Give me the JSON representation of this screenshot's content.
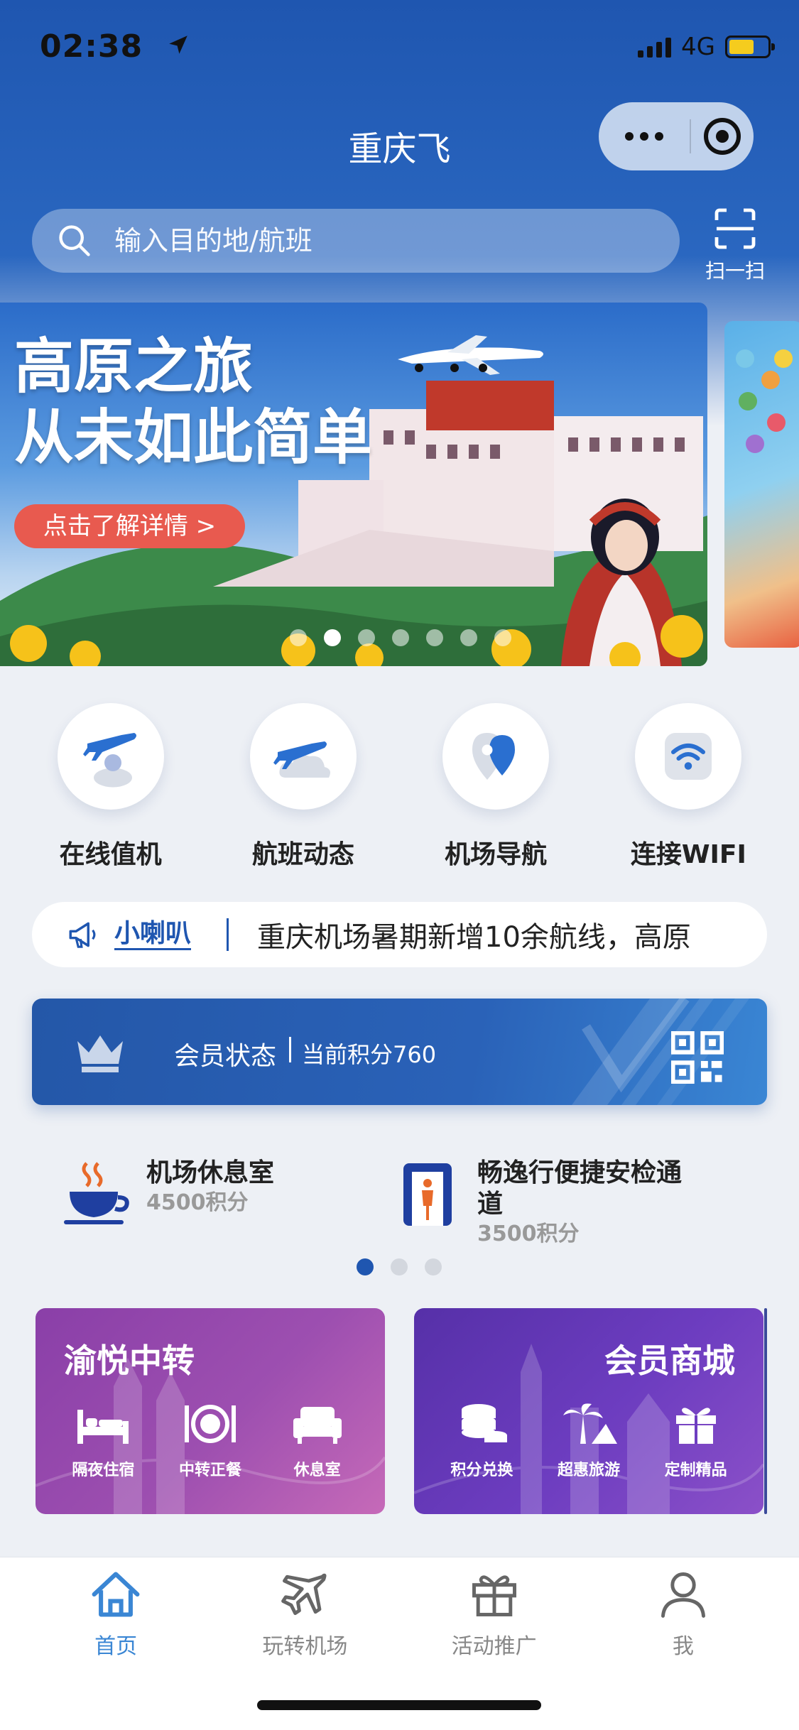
{
  "status_bar": {
    "time": "02:38",
    "network": "4G"
  },
  "header": {
    "title": "重庆飞"
  },
  "search": {
    "placeholder": "输入目的地/航班",
    "scan_label": "扫一扫"
  },
  "banner": {
    "headline_1": "高原之旅",
    "headline_2": "从未如此简单",
    "cta": "点击了解详情 >",
    "slide_count": 7,
    "active_slide": 2
  },
  "quick_actions": [
    {
      "label": "在线值机",
      "icon": "plane-person-icon"
    },
    {
      "label": "航班动态",
      "icon": "plane-cloud-icon"
    },
    {
      "label": "机场导航",
      "icon": "map-pin-icon"
    },
    {
      "label": "连接WIFI",
      "icon": "wifi-icon"
    }
  ],
  "notice": {
    "tag": "小喇叭",
    "text": "重庆机场暑期新增10余航线，高原"
  },
  "member": {
    "status_label": "会员状态",
    "points_text": "当前积分760"
  },
  "benefits": [
    {
      "name": "机场休息室",
      "points": "4500积分",
      "icon": "coffee-cup-icon"
    },
    {
      "name": "畅逸行便捷安检通道",
      "points": "3500积分",
      "icon": "security-gate-icon"
    }
  ],
  "benefit_pages": 3,
  "cards": [
    {
      "title": "渝悦中转",
      "items": [
        {
          "label": "隔夜住宿",
          "icon": "bed-icon"
        },
        {
          "label": "中转正餐",
          "icon": "dining-icon"
        },
        {
          "label": "休息室",
          "icon": "sofa-icon"
        }
      ]
    },
    {
      "title": "会员商城",
      "items": [
        {
          "label": "积分兑换",
          "icon": "coins-icon"
        },
        {
          "label": "超惠旅游",
          "icon": "palm-icon"
        },
        {
          "label": "定制精品",
          "icon": "gift-icon"
        }
      ]
    }
  ],
  "tabs": [
    {
      "label": "首页",
      "icon": "home-icon",
      "active": true
    },
    {
      "label": "玩转机场",
      "icon": "airplane-icon",
      "active": false
    },
    {
      "label": "活动推广",
      "icon": "gift-icon",
      "active": false
    },
    {
      "label": "我",
      "icon": "person-icon",
      "active": false
    }
  ],
  "colors": {
    "brand": "#1f56b0",
    "accent": "#3a86d4",
    "cta": "#e85a4f"
  }
}
